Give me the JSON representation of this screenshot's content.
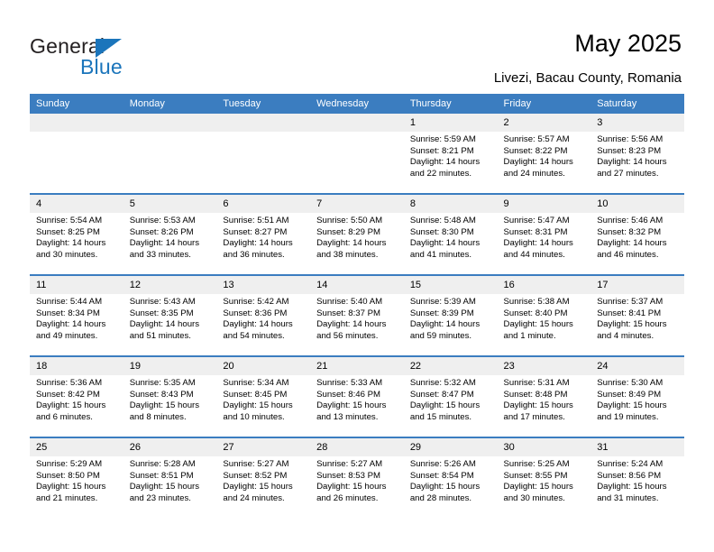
{
  "brand": {
    "name_top": "General",
    "name_bottom": "Blue",
    "color_blue": "#1b75bb"
  },
  "header": {
    "title": "May 2025",
    "subtitle": "Livezi, Bacau County, Romania"
  },
  "calendar": {
    "accent_color": "#3b7dc0",
    "daynum_bg": "#efefef",
    "weekdays": [
      "Sunday",
      "Monday",
      "Tuesday",
      "Wednesday",
      "Thursday",
      "Friday",
      "Saturday"
    ],
    "weeks": [
      [
        {
          "day": "",
          "lines": []
        },
        {
          "day": "",
          "lines": []
        },
        {
          "day": "",
          "lines": []
        },
        {
          "day": "",
          "lines": []
        },
        {
          "day": "1",
          "lines": [
            "Sunrise: 5:59 AM",
            "Sunset: 8:21 PM",
            "Daylight: 14 hours",
            "and 22 minutes."
          ]
        },
        {
          "day": "2",
          "lines": [
            "Sunrise: 5:57 AM",
            "Sunset: 8:22 PM",
            "Daylight: 14 hours",
            "and 24 minutes."
          ]
        },
        {
          "day": "3",
          "lines": [
            "Sunrise: 5:56 AM",
            "Sunset: 8:23 PM",
            "Daylight: 14 hours",
            "and 27 minutes."
          ]
        }
      ],
      [
        {
          "day": "4",
          "lines": [
            "Sunrise: 5:54 AM",
            "Sunset: 8:25 PM",
            "Daylight: 14 hours",
            "and 30 minutes."
          ]
        },
        {
          "day": "5",
          "lines": [
            "Sunrise: 5:53 AM",
            "Sunset: 8:26 PM",
            "Daylight: 14 hours",
            "and 33 minutes."
          ]
        },
        {
          "day": "6",
          "lines": [
            "Sunrise: 5:51 AM",
            "Sunset: 8:27 PM",
            "Daylight: 14 hours",
            "and 36 minutes."
          ]
        },
        {
          "day": "7",
          "lines": [
            "Sunrise: 5:50 AM",
            "Sunset: 8:29 PM",
            "Daylight: 14 hours",
            "and 38 minutes."
          ]
        },
        {
          "day": "8",
          "lines": [
            "Sunrise: 5:48 AM",
            "Sunset: 8:30 PM",
            "Daylight: 14 hours",
            "and 41 minutes."
          ]
        },
        {
          "day": "9",
          "lines": [
            "Sunrise: 5:47 AM",
            "Sunset: 8:31 PM",
            "Daylight: 14 hours",
            "and 44 minutes."
          ]
        },
        {
          "day": "10",
          "lines": [
            "Sunrise: 5:46 AM",
            "Sunset: 8:32 PM",
            "Daylight: 14 hours",
            "and 46 minutes."
          ]
        }
      ],
      [
        {
          "day": "11",
          "lines": [
            "Sunrise: 5:44 AM",
            "Sunset: 8:34 PM",
            "Daylight: 14 hours",
            "and 49 minutes."
          ]
        },
        {
          "day": "12",
          "lines": [
            "Sunrise: 5:43 AM",
            "Sunset: 8:35 PM",
            "Daylight: 14 hours",
            "and 51 minutes."
          ]
        },
        {
          "day": "13",
          "lines": [
            "Sunrise: 5:42 AM",
            "Sunset: 8:36 PM",
            "Daylight: 14 hours",
            "and 54 minutes."
          ]
        },
        {
          "day": "14",
          "lines": [
            "Sunrise: 5:40 AM",
            "Sunset: 8:37 PM",
            "Daylight: 14 hours",
            "and 56 minutes."
          ]
        },
        {
          "day": "15",
          "lines": [
            "Sunrise: 5:39 AM",
            "Sunset: 8:39 PM",
            "Daylight: 14 hours",
            "and 59 minutes."
          ]
        },
        {
          "day": "16",
          "lines": [
            "Sunrise: 5:38 AM",
            "Sunset: 8:40 PM",
            "Daylight: 15 hours",
            "and 1 minute."
          ]
        },
        {
          "day": "17",
          "lines": [
            "Sunrise: 5:37 AM",
            "Sunset: 8:41 PM",
            "Daylight: 15 hours",
            "and 4 minutes."
          ]
        }
      ],
      [
        {
          "day": "18",
          "lines": [
            "Sunrise: 5:36 AM",
            "Sunset: 8:42 PM",
            "Daylight: 15 hours",
            "and 6 minutes."
          ]
        },
        {
          "day": "19",
          "lines": [
            "Sunrise: 5:35 AM",
            "Sunset: 8:43 PM",
            "Daylight: 15 hours",
            "and 8 minutes."
          ]
        },
        {
          "day": "20",
          "lines": [
            "Sunrise: 5:34 AM",
            "Sunset: 8:45 PM",
            "Daylight: 15 hours",
            "and 10 minutes."
          ]
        },
        {
          "day": "21",
          "lines": [
            "Sunrise: 5:33 AM",
            "Sunset: 8:46 PM",
            "Daylight: 15 hours",
            "and 13 minutes."
          ]
        },
        {
          "day": "22",
          "lines": [
            "Sunrise: 5:32 AM",
            "Sunset: 8:47 PM",
            "Daylight: 15 hours",
            "and 15 minutes."
          ]
        },
        {
          "day": "23",
          "lines": [
            "Sunrise: 5:31 AM",
            "Sunset: 8:48 PM",
            "Daylight: 15 hours",
            "and 17 minutes."
          ]
        },
        {
          "day": "24",
          "lines": [
            "Sunrise: 5:30 AM",
            "Sunset: 8:49 PM",
            "Daylight: 15 hours",
            "and 19 minutes."
          ]
        }
      ],
      [
        {
          "day": "25",
          "lines": [
            "Sunrise: 5:29 AM",
            "Sunset: 8:50 PM",
            "Daylight: 15 hours",
            "and 21 minutes."
          ]
        },
        {
          "day": "26",
          "lines": [
            "Sunrise: 5:28 AM",
            "Sunset: 8:51 PM",
            "Daylight: 15 hours",
            "and 23 minutes."
          ]
        },
        {
          "day": "27",
          "lines": [
            "Sunrise: 5:27 AM",
            "Sunset: 8:52 PM",
            "Daylight: 15 hours",
            "and 24 minutes."
          ]
        },
        {
          "day": "28",
          "lines": [
            "Sunrise: 5:27 AM",
            "Sunset: 8:53 PM",
            "Daylight: 15 hours",
            "and 26 minutes."
          ]
        },
        {
          "day": "29",
          "lines": [
            "Sunrise: 5:26 AM",
            "Sunset: 8:54 PM",
            "Daylight: 15 hours",
            "and 28 minutes."
          ]
        },
        {
          "day": "30",
          "lines": [
            "Sunrise: 5:25 AM",
            "Sunset: 8:55 PM",
            "Daylight: 15 hours",
            "and 30 minutes."
          ]
        },
        {
          "day": "31",
          "lines": [
            "Sunrise: 5:24 AM",
            "Sunset: 8:56 PM",
            "Daylight: 15 hours",
            "and 31 minutes."
          ]
        }
      ]
    ]
  }
}
